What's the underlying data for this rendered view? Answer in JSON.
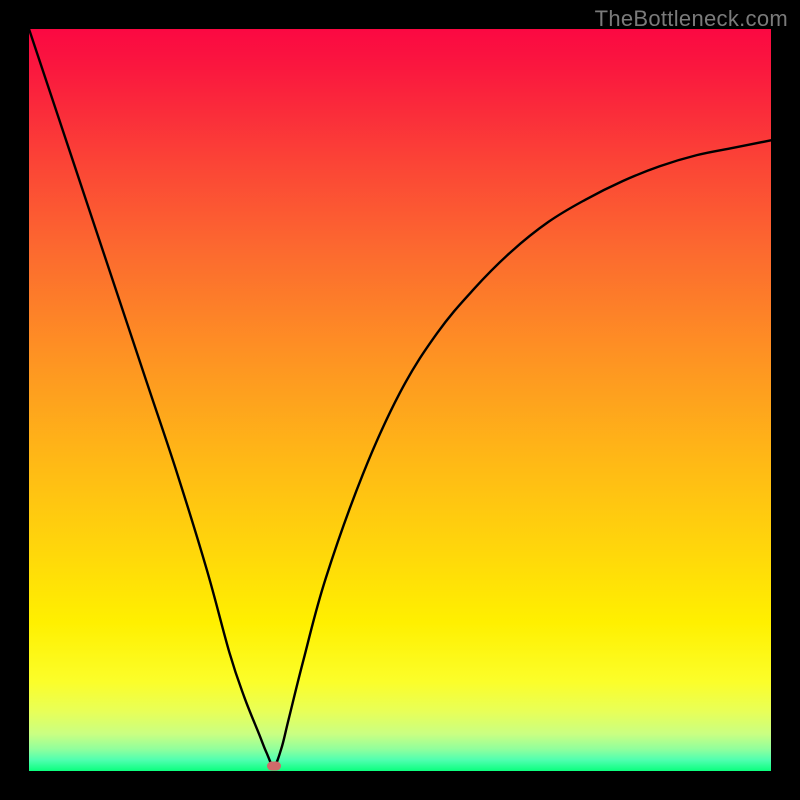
{
  "watermark": "TheBottleneck.com",
  "chart_data": {
    "type": "line",
    "title": "",
    "xlabel": "",
    "ylabel": "",
    "xlim": [
      0,
      100
    ],
    "ylim": [
      0,
      100
    ],
    "grid": false,
    "notes": "V-shaped bottleneck curve on a red→green vertical gradient. Axes unlabeled; background color encodes bottleneck severity (red=high, green=low). Curve starts near top-left, dips to a minimum around x≈33 at the baseline, then rises asymptotically toward the right. Small pink marker at the minimum.",
    "minimum_marker": {
      "x": 33,
      "y": 0.7
    },
    "series": [
      {
        "name": "bottleneck-curve",
        "x": [
          0,
          4,
          8,
          12,
          16,
          20,
          24,
          27,
          29,
          31,
          32,
          33,
          34,
          35,
          37,
          40,
          45,
          50,
          55,
          60,
          65,
          70,
          75,
          80,
          85,
          90,
          95,
          100
        ],
        "y": [
          100,
          88,
          76,
          64,
          52,
          40,
          27,
          16,
          10,
          5,
          2.5,
          0.7,
          3,
          7,
          15,
          26,
          40,
          51,
          59,
          65,
          70,
          74,
          77,
          79.5,
          81.5,
          83,
          84,
          85
        ]
      }
    ],
    "gradient_stops": [
      {
        "pos": 0,
        "color": "#fb0842"
      },
      {
        "pos": 0.3,
        "color": "#fc6a2f"
      },
      {
        "pos": 0.58,
        "color": "#ffb816"
      },
      {
        "pos": 0.8,
        "color": "#fff000"
      },
      {
        "pos": 0.95,
        "color": "#caff82"
      },
      {
        "pos": 1.0,
        "color": "#0bff7e"
      }
    ]
  }
}
